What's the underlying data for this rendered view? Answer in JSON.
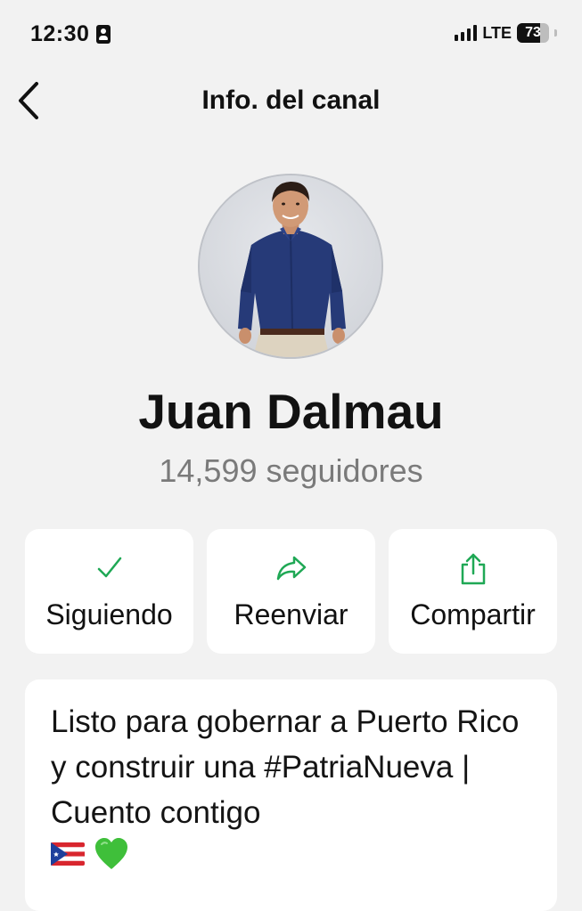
{
  "status_bar": {
    "time": "12:30",
    "network": "LTE",
    "battery_percent": "73",
    "battery_level": 0.73
  },
  "header": {
    "title": "Info. del canal",
    "back_icon": "chevron-left-icon"
  },
  "channel": {
    "name": "Juan Dalmau",
    "followers": "14,599 seguidores"
  },
  "actions": [
    {
      "label": "Siguiendo",
      "icon": "checkmark-icon"
    },
    {
      "label": "Reenviar",
      "icon": "forward-arrow-icon"
    },
    {
      "label": "Compartir",
      "icon": "share-icon"
    }
  ],
  "description": {
    "text": "Listo para gobernar a Puerto Rico y construir una #PatriaNueva | Cuento contigo",
    "emojis": [
      "puerto-rico-flag-icon",
      "green-heart-icon"
    ]
  },
  "colors": {
    "accent": "#1fa855",
    "background": "#f2f2f2",
    "card": "#ffffff"
  }
}
